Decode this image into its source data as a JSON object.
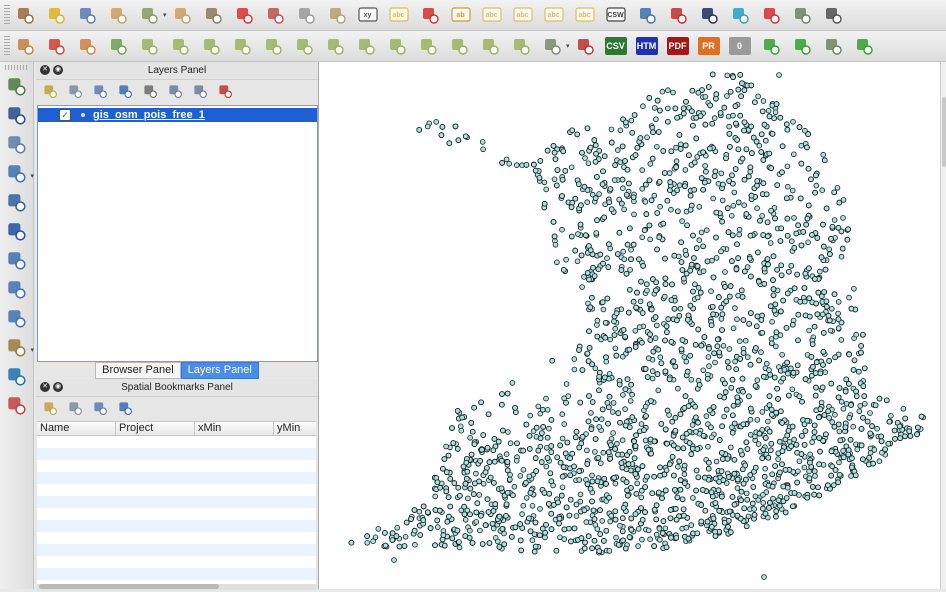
{
  "toolbar_row1": [
    {
      "name": "digitize-icon",
      "color": "#9a6a3a"
    },
    {
      "name": "toggle-editing-icon",
      "color": "#e0b020"
    },
    {
      "name": "save-edits-icon",
      "color": "#5a7ab0"
    },
    {
      "name": "add-feature-icon",
      "color": "#c9a060"
    },
    {
      "name": "move-feature-icon",
      "color": "#8a9a60",
      "dropdown": true
    },
    {
      "name": "node-tool-icon",
      "color": "#c9a060"
    },
    {
      "name": "node-edit-icon",
      "color": "#8a7a60"
    },
    {
      "name": "delete-selected-icon",
      "color": "#d83030"
    },
    {
      "name": "cut-features-icon",
      "color": "#c05050"
    },
    {
      "name": "copy-features-icon",
      "color": "#9a9a9a"
    },
    {
      "name": "paste-features-icon",
      "color": "#b0a070"
    },
    {
      "name": "xy-tool-icon",
      "color": "#555555",
      "text": "xy"
    },
    {
      "name": "label-icon",
      "color": "#e0c040",
      "text": "abc"
    },
    {
      "name": "diagram-icon",
      "color": "#d03030"
    },
    {
      "name": "label-pin-icon",
      "color": "#d0a020",
      "text": "ab"
    },
    {
      "name": "label-show-icon",
      "color": "#e0c060",
      "text": "abc"
    },
    {
      "name": "label-move-icon",
      "color": "#e0c060",
      "text": "abc"
    },
    {
      "name": "label-rotate-icon",
      "color": "#e0c060",
      "text": "abc"
    },
    {
      "name": "label-change-icon",
      "color": "#e0c060",
      "text": "abc"
    },
    {
      "name": "csw-icon",
      "color": "#444444",
      "text": "CSW"
    },
    {
      "name": "python-console-icon",
      "color": "#3a70b0"
    },
    {
      "name": "plugin-grid-icon",
      "color": "#c03030"
    },
    {
      "name": "plugin-curve-icon",
      "color": "#203060"
    },
    {
      "name": "plugin-m-icon",
      "color": "#2aa0c0"
    },
    {
      "name": "plugin-refresh-icon",
      "color": "#d03030"
    },
    {
      "name": "plugin-tool-icon",
      "color": "#708060"
    },
    {
      "name": "plugin-zoom-icon",
      "color": "#505050"
    }
  ],
  "toolbar_row2": [
    {
      "name": "measure-icon",
      "color": "#c08040"
    },
    {
      "name": "magnet-icon",
      "color": "#d04030"
    },
    {
      "name": "undo-icon",
      "color": "#d08040"
    },
    {
      "name": "redo-icon",
      "color": "#70a050"
    },
    {
      "name": "adv-edit-1-icon",
      "color": "#9ab060"
    },
    {
      "name": "adv-edit-2-icon",
      "color": "#9ab060"
    },
    {
      "name": "adv-edit-3-icon",
      "color": "#9ab060"
    },
    {
      "name": "adv-edit-4-icon",
      "color": "#9ab060"
    },
    {
      "name": "adv-edit-5-icon",
      "color": "#9ab060"
    },
    {
      "name": "adv-edit-6-icon",
      "color": "#9ab060"
    },
    {
      "name": "adv-edit-7-icon",
      "color": "#9ab060"
    },
    {
      "name": "adv-edit-8-icon",
      "color": "#9ab060"
    },
    {
      "name": "adv-edit-9-icon",
      "color": "#9ab060"
    },
    {
      "name": "adv-edit-10-icon",
      "color": "#9ab060"
    },
    {
      "name": "adv-edit-11-icon",
      "color": "#9ab060"
    },
    {
      "name": "adv-edit-12-icon",
      "color": "#9ab060"
    },
    {
      "name": "adv-edit-13-icon",
      "color": "#9ab060"
    },
    {
      "name": "rotate-feature-icon",
      "color": "#7a8a6a",
      "dropdown": true
    },
    {
      "name": "qgis-cloud-icon",
      "color": "#c03030"
    },
    {
      "name": "export-csv-button",
      "color": "#2a7a30",
      "text": "CSV",
      "badge": true
    },
    {
      "name": "export-html-button",
      "color": "#2030b0",
      "text": "HTM",
      "badge": true
    },
    {
      "name": "export-pdf-button",
      "color": "#a01818",
      "text": "PDF",
      "badge": true
    },
    {
      "name": "export-pr-button",
      "color": "#e07020",
      "text": "PR",
      "badge": true
    },
    {
      "name": "counter-badge",
      "color": "#9a9a9a",
      "text": "0",
      "badge": true
    },
    {
      "name": "add-green-icon",
      "color": "#30a030"
    },
    {
      "name": "add-ring-icon",
      "color": "#30a030"
    },
    {
      "name": "split-icon",
      "color": "#708060"
    },
    {
      "name": "plugin-globe-icon",
      "color": "#30a030"
    }
  ],
  "left_toolbar": [
    {
      "name": "add-vector-layer-icon",
      "color": "#4a7a40"
    },
    {
      "name": "add-raster-layer-icon",
      "color": "#2a4a8a"
    },
    {
      "name": "add-postgis-layer-icon",
      "color": "#5a7aa0"
    },
    {
      "name": "add-spatialite-layer-icon",
      "color": "#3a70b0",
      "dropdown": true
    },
    {
      "name": "add-wms-layer-icon",
      "color": "#3060a0"
    },
    {
      "name": "add-wcs-layer-icon",
      "color": "#2050a0"
    },
    {
      "name": "add-wfs-layer-icon",
      "color": "#3a70b0"
    },
    {
      "name": "add-delimited-layer-icon",
      "color": "#4070b0"
    },
    {
      "name": "add-virtual-layer-icon",
      "color": "#4070b0"
    },
    {
      "name": "new-layer-icon",
      "color": "#9a7a40",
      "dropdown": true
    },
    {
      "name": "globe-icon",
      "color": "#2070b0"
    },
    {
      "name": "vector-tools-icon",
      "color": "#c04040"
    }
  ],
  "layers_panel": {
    "title": "Layers Panel",
    "toolbar": [
      "paint-brush-icon",
      "add-group-icon",
      "eye-icon",
      "filter-icon",
      "expression-filter-icon",
      "expand-all-icon",
      "collapse-all-icon",
      "remove-layer-icon"
    ],
    "layers": [
      {
        "name": "gis_osm_pois_free_1",
        "checked": true,
        "selected": true
      }
    ]
  },
  "panel_tabs": [
    {
      "label": "Browser Panel",
      "active": false
    },
    {
      "label": "Layers Panel",
      "active": true
    }
  ],
  "bookmarks_panel": {
    "title": "Spatial Bookmarks Panel",
    "toolbar": [
      "zoom-to-bookmark-icon",
      "new-bookmark-icon",
      "delete-bookmark-icon",
      "share-bookmark-icon"
    ],
    "columns": [
      "Name",
      "Project",
      "xMin",
      "yMin"
    ]
  },
  "map": {
    "point_fill": "#a8e4e4",
    "point_stroke": "#1a1a1a"
  }
}
